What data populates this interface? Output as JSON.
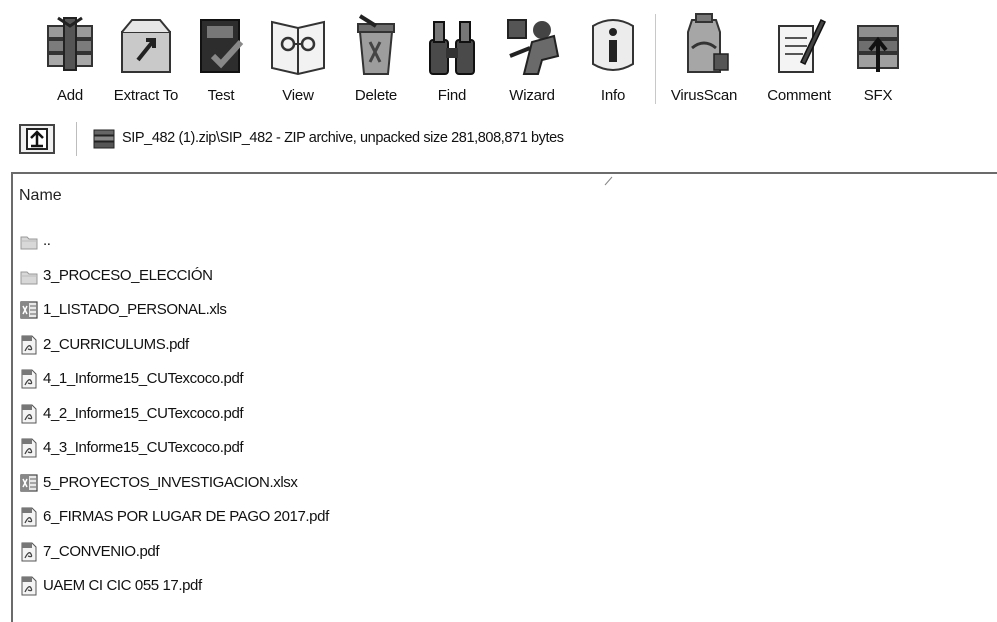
{
  "toolbar": {
    "buttons": [
      {
        "label": "Add",
        "icon": "add-archive-icon"
      },
      {
        "label": "Extract To",
        "icon": "extract-to-icon"
      },
      {
        "label": "Test",
        "icon": "test-icon"
      },
      {
        "label": "View",
        "icon": "view-icon"
      },
      {
        "label": "Delete",
        "icon": "delete-icon"
      },
      {
        "label": "Find",
        "icon": "find-icon"
      },
      {
        "label": "Wizard",
        "icon": "wizard-icon"
      },
      {
        "label": "Info",
        "icon": "info-icon"
      },
      {
        "label": "VirusScan",
        "icon": "virusscan-icon"
      },
      {
        "label": "Comment",
        "icon": "comment-icon"
      },
      {
        "label": "SFX",
        "icon": "sfx-icon"
      }
    ]
  },
  "address": {
    "path": "SIP_482 (1).zip\\SIP_482 - ZIP archive, unpacked size 281,808,871 bytes"
  },
  "list": {
    "column_name": "Name",
    "rows": [
      {
        "name": "..",
        "type": "folder-up"
      },
      {
        "name": "3_PROCESO_ELECCIÓN",
        "type": "folder"
      },
      {
        "name": "1_LISTADO_PERSONAL.xls",
        "type": "excel"
      },
      {
        "name": "2_CURRICULUMS.pdf",
        "type": "pdf"
      },
      {
        "name": "4_1_Informe15_CUTexcoco.pdf",
        "type": "pdf"
      },
      {
        "name": "4_2_Informe15_CUTexcoco.pdf",
        "type": "pdf"
      },
      {
        "name": "4_3_Informe15_CUTexcoco.pdf",
        "type": "pdf"
      },
      {
        "name": "5_PROYECTOS_INVESTIGACION.xlsx",
        "type": "excel"
      },
      {
        "name": "6_FIRMAS POR LUGAR DE PAGO 2017.pdf",
        "type": "pdf"
      },
      {
        "name": "7_CONVENIO.pdf",
        "type": "pdf"
      },
      {
        "name": "UAEM CI CIC 055 17.pdf",
        "type": "pdf"
      }
    ]
  }
}
